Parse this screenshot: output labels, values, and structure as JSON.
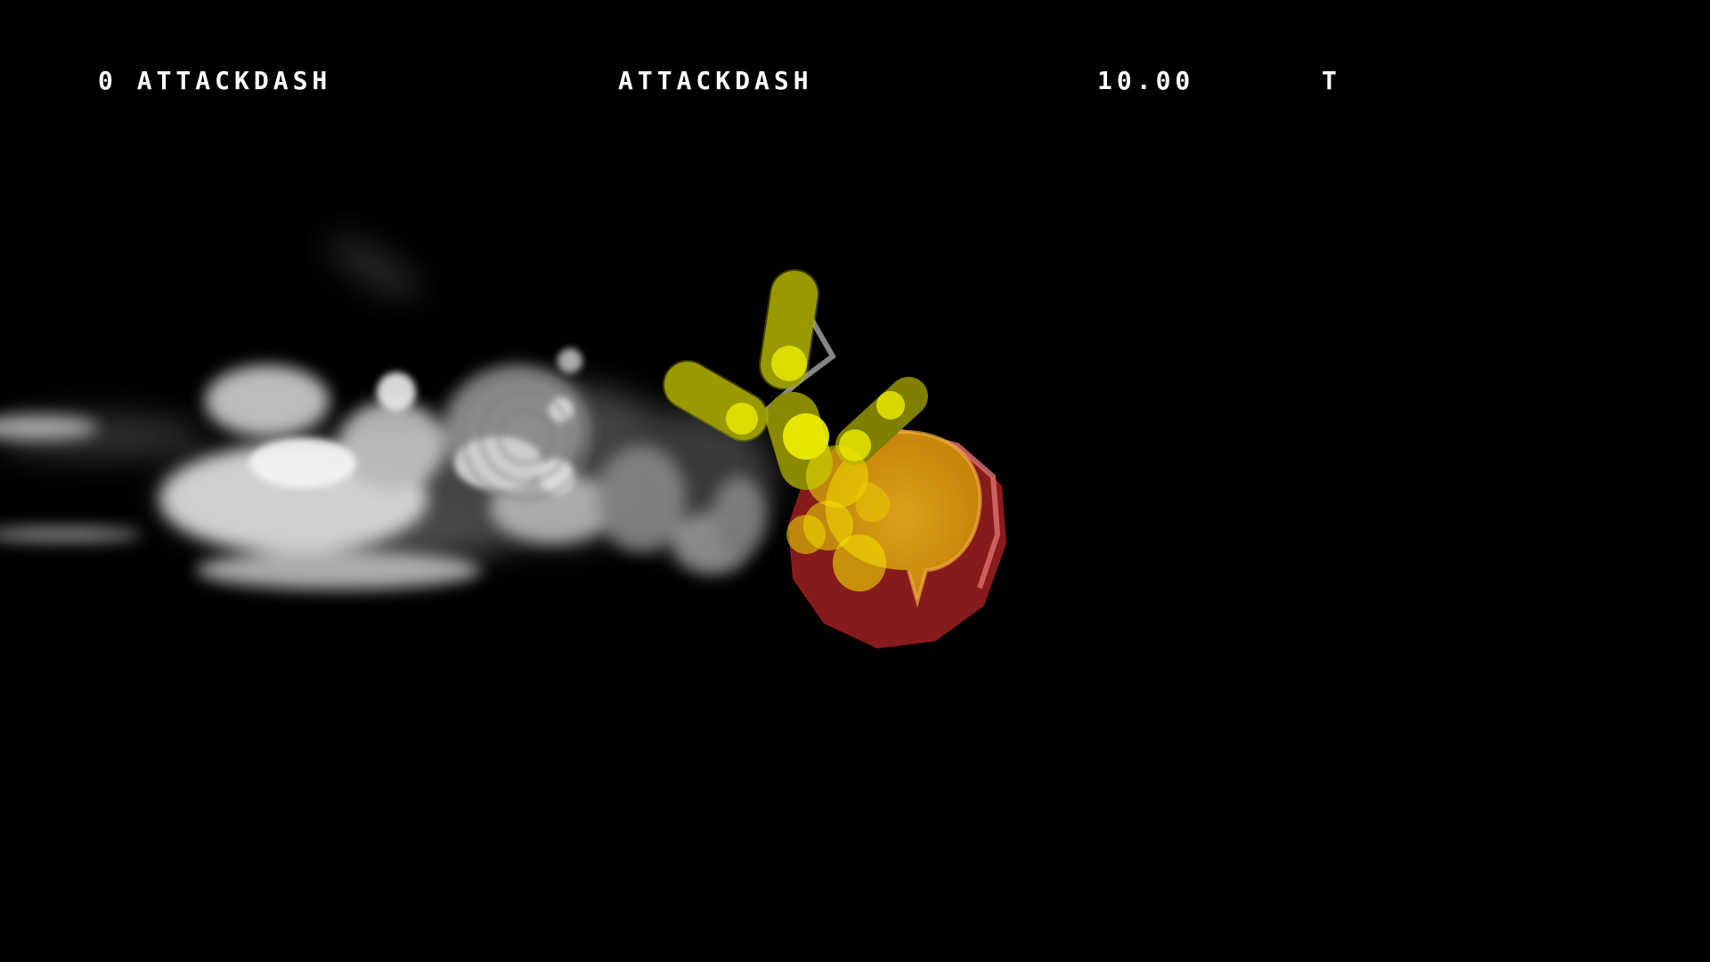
{
  "hud": {
    "move_info": "0 ATTACKDASH",
    "move_name": "ATTACKDASH",
    "timer": "10.00",
    "flag": "T"
  },
  "colors": {
    "background": "#000000",
    "hud_text": "#ffffff",
    "hurtbox_yellow": "#c8c800",
    "hurtbox_highlight": "#f0f000",
    "hitbox_red": "#8b1a1a",
    "hitbox_orange": "#d89a10",
    "smoke": "#d8d8d8"
  },
  "scene": {
    "effect": "dust-cloud-trail",
    "character": "attack-dash-hitbox-visualization"
  }
}
